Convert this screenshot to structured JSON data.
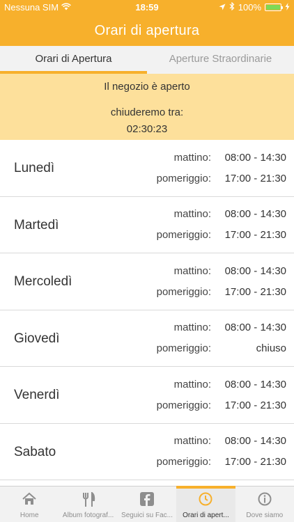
{
  "statusbar": {
    "carrier": "Nessuna SIM",
    "time": "18:59",
    "battery": "100%",
    "battery_level": 1.0
  },
  "navbar": {
    "title": "Orari di apertura"
  },
  "segments": [
    {
      "label": "Orari di Apertura",
      "active": true
    },
    {
      "label": "Aperture Straordinarie",
      "active": false
    }
  ],
  "status": {
    "open_text": "Il negozio è aperto",
    "closing_label": "chiuderemo tra:",
    "countdown": "02:30:23"
  },
  "days": [
    {
      "name": "Lunedì",
      "rows": [
        {
          "label": "mattino:",
          "value": "08:00 - 14:30"
        },
        {
          "label": "pomeriggio:",
          "value": "17:00 - 21:30"
        }
      ]
    },
    {
      "name": "Martedì",
      "rows": [
        {
          "label": "mattino:",
          "value": "08:00 - 14:30"
        },
        {
          "label": "pomeriggio:",
          "value": "17:00 - 21:30"
        }
      ]
    },
    {
      "name": "Mercoledì",
      "rows": [
        {
          "label": "mattino:",
          "value": "08:00 - 14:30"
        },
        {
          "label": "pomeriggio:",
          "value": "17:00 - 21:30"
        }
      ]
    },
    {
      "name": "Giovedì",
      "rows": [
        {
          "label": "mattino:",
          "value": "08:00 - 14:30"
        },
        {
          "label": "pomeriggio:",
          "value": "chiuso"
        }
      ]
    },
    {
      "name": "Venerdì",
      "rows": [
        {
          "label": "mattino:",
          "value": "08:00 - 14:30"
        },
        {
          "label": "pomeriggio:",
          "value": "17:00 - 21:30"
        }
      ]
    },
    {
      "name": "Sabato",
      "rows": [
        {
          "label": "mattino:",
          "value": "08:00 - 14:30"
        },
        {
          "label": "pomeriggio:",
          "value": "17:00 - 21:30"
        }
      ]
    },
    {
      "name": "",
      "rows": []
    }
  ],
  "tabbar": [
    {
      "label": "Home",
      "icon": "home-icon"
    },
    {
      "label": "Album fotograf...",
      "icon": "fork-knife-icon"
    },
    {
      "label": "Seguici su Fac...",
      "icon": "facebook-icon"
    },
    {
      "label": "Orari di apert...",
      "icon": "clock-icon",
      "active": true
    },
    {
      "label": "Dove siamo",
      "icon": "info-icon"
    }
  ],
  "colors": {
    "accent": "#f7b02c",
    "banner": "#fde09b",
    "battery_fill": "#7ed957"
  }
}
